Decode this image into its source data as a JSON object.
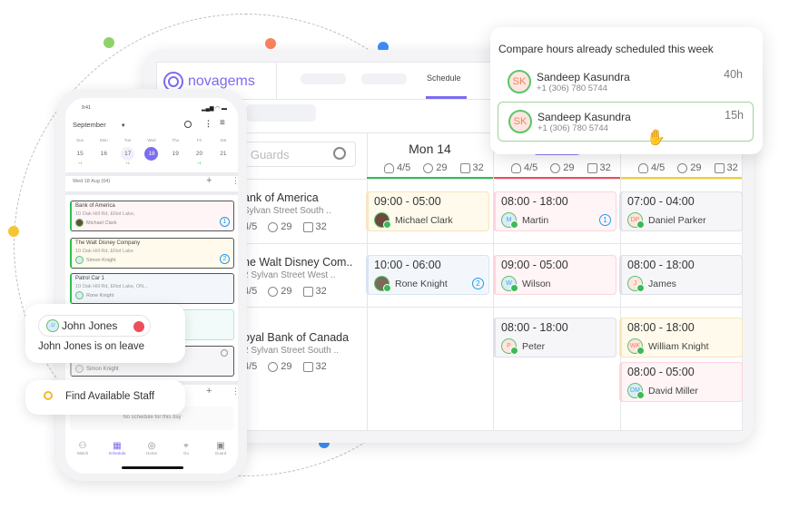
{
  "colors": {
    "accent": "#7b6cf0",
    "green": "#2dbf4f",
    "red": "#f04c5a",
    "yellow": "#f5cf2a",
    "badge": "#1e9bf0"
  },
  "desktop": {
    "logo": "novagems",
    "tabs": [
      {
        "label": "Schedule",
        "active": true
      }
    ],
    "search_placeholder": "Search Guards",
    "search_visible": "n Guards",
    "days": [
      {
        "label": "Mon 14",
        "guards": "4/5",
        "hours": "29",
        "shifts": "32",
        "color": "#2dbf4f"
      },
      {
        "label": "",
        "guards": "4/5",
        "hours": "29",
        "shifts": "32",
        "color": "#f04c5a"
      },
      {
        "label": "",
        "guards": "4/5",
        "hours": "29",
        "shifts": "32",
        "color": "#f5cf2a"
      }
    ],
    "sites": [
      {
        "name": "ank of America",
        "address": "Sylvan Street South ..",
        "guards": "4/5",
        "hours": "29",
        "shifts": "32"
      },
      {
        "name": "he Walt Disney Com..",
        "address": "2 Sylvan Street West ..",
        "guards": "4/5",
        "hours": "29",
        "shifts": "32"
      },
      {
        "name": "oyal Bank of Canada",
        "address": "2 Sylvan Street South ..",
        "guards": "4/5",
        "hours": "29",
        "shifts": "32"
      }
    ],
    "shifts": [
      {
        "time": "09:00 - 05:00",
        "name": "Michael Clark",
        "initials": "",
        "badge": ""
      },
      {
        "time": "08:00 - 18:00",
        "name": "Martin",
        "initials": "M",
        "badge": "1"
      },
      {
        "time": "07:00 - 04:00",
        "name": "Daniel Parker",
        "initials": "DP",
        "badge": ""
      },
      {
        "time": "10:00 - 06:00",
        "name": "Rone Knight",
        "initials": "",
        "badge": "2"
      },
      {
        "time": "09:00 - 05:00",
        "name": "Wilson",
        "initials": "W",
        "badge": ""
      },
      {
        "time": "08:00 - 18:00",
        "name": "James",
        "initials": "J",
        "badge": ""
      },
      {
        "time": "08:00 - 18:00",
        "name": "Peter",
        "initials": "P",
        "badge": ""
      },
      {
        "time": "08:00 - 18:00",
        "name": "William Knight",
        "initials": "WK",
        "badge": ""
      },
      {
        "time": "08:00 - 05:00",
        "name": "David Miller",
        "initials": "DM",
        "badge": ""
      }
    ]
  },
  "popup": {
    "title": "Compare hours already scheduled this week",
    "rows": [
      {
        "initials": "SK",
        "name": "Sandeep Kasundra",
        "phone": "+1 (306) 780 5744",
        "hours": "40h",
        "selected": false
      },
      {
        "initials": "SK",
        "name": "Sandeep Kasundra",
        "phone": "+1 (306) 780 5744",
        "hours": "15h",
        "selected": true
      }
    ]
  },
  "phone": {
    "time": "9:41",
    "month": "September",
    "weekdays": [
      "Sun",
      "Mon",
      "Tue",
      "Wed",
      "Thu",
      "Fri",
      "Sat"
    ],
    "dates": [
      "15",
      "16",
      "17",
      "18",
      "19",
      "20",
      "21"
    ],
    "selected_date": "18",
    "date_marks": [
      "+1",
      "",
      "+1",
      "",
      "",
      "+1",
      ""
    ],
    "section1": "Wed 18 Aug (04)",
    "cards": [
      {
        "title": "Bank of America",
        "address": "10 Oak Hill Rd, Elliot Lake,",
        "person": "Michael Clark",
        "badge": "1"
      },
      {
        "title": "The Walt Disney Company",
        "address": "10 Oak Hill Rd, Elliot Lake",
        "person": "Simon Knight",
        "badge": "2"
      },
      {
        "title": "Patrol Car 1",
        "address": "10 Oak Hill Rd, Elliot Lake, ON...",
        "person": "Rone Knight",
        "badge": ""
      },
      {
        "title": "",
        "address": "",
        "person": "",
        "badge": ""
      },
      {
        "title": "",
        "address": "",
        "person": "Simon Knight",
        "badge": ""
      }
    ],
    "empty_text": "No schedule for this day",
    "nav": [
      {
        "label": "Watch"
      },
      {
        "label": "Schedule",
        "active": true
      },
      {
        "label": "Home"
      },
      {
        "label": "Go"
      },
      {
        "label": "Guard"
      }
    ]
  },
  "leave_card": {
    "initials": "JJ",
    "name": "John Jones",
    "message": "John Jones is on leave"
  },
  "find_staff": {
    "label": "Find Available Staff"
  }
}
